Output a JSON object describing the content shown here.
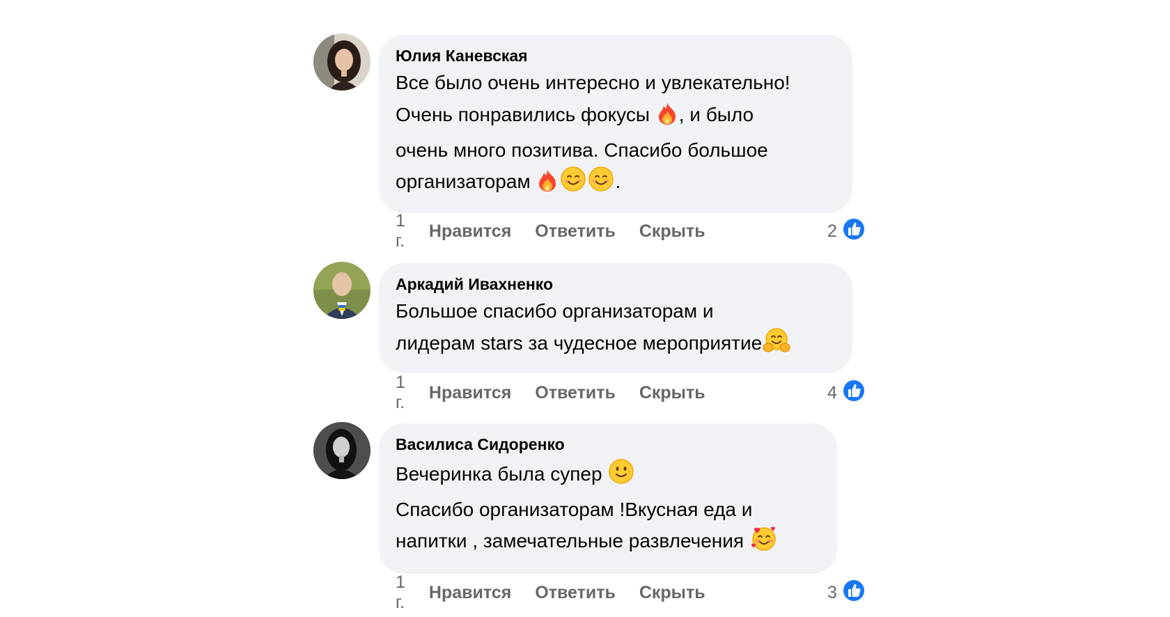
{
  "comments": [
    {
      "author": "Юлия Каневская",
      "lines": [
        "Все было очень интересно и увлекательно!",
        "Очень понравились фокусы ",
        ", и было",
        "очень много позитива. Спасибо большое",
        "организаторам ",
        "."
      ],
      "time": "1 г.",
      "like": "Нравится",
      "reply": "Ответить",
      "hide": "Скрыть",
      "likes_count": "2"
    },
    {
      "author": "Аркадий Ивахненко",
      "lines": [
        "Большое спасибо организаторам и",
        "лидерам stars за чудесное мероприятие"
      ],
      "time": "1 г.",
      "like": "Нравится",
      "reply": "Ответить",
      "hide": "Скрыть",
      "likes_count": "4"
    },
    {
      "author": "Василиса Сидоренко",
      "lines": [
        "Вечеринка была супер ",
        "Спасибо организаторам !Вкусная еда и",
        "напитки , замечательные развлечения "
      ],
      "time": "1 г.",
      "like": "Нравится",
      "reply": "Ответить",
      "hide": "Скрыть",
      "likes_count": "3"
    }
  ],
  "colors": {
    "bubble": "#f0f2f5",
    "meta": "#65676b",
    "like_blue": "#1877f2"
  },
  "icons": [
    "fire-emoji",
    "smiling-face-emoji",
    "hugging-face-emoji",
    "slight-smile-emoji",
    "smiling-face-with-hearts-emoji",
    "thumbs-up-icon"
  ]
}
